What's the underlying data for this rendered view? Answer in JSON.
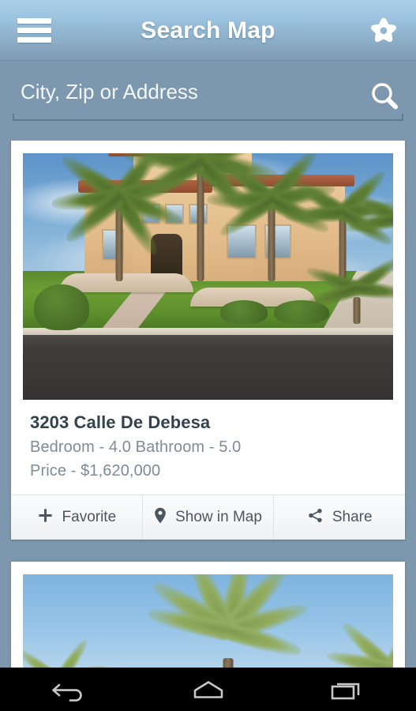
{
  "header": {
    "title": "Search Map",
    "menu_icon": "hamburger-menu-icon",
    "favorites_icon": "star-icon"
  },
  "search": {
    "placeholder": "City, Zip or Address",
    "value": "",
    "icon": "search-icon"
  },
  "listings": [
    {
      "address": "3203 Calle De Debesa",
      "beds_baths": "Bedroom - 4.0 Bathroom - 5.0",
      "price": "Price - $1,620,000",
      "photo_alt": "mediterranean-villa-with-palm-trees",
      "actions": [
        {
          "label": "Favorite",
          "icon": "plus-icon"
        },
        {
          "label": "Show in Map",
          "icon": "map-pin-icon"
        },
        {
          "label": "Share",
          "icon": "share-icon"
        }
      ]
    },
    {
      "photo_alt": "palm-trees-against-blue-sky"
    }
  ],
  "navbar": {
    "back": "back-icon",
    "home": "home-icon",
    "recents": "recents-icon"
  },
  "colors": {
    "page_background": "#7d97ae",
    "appbar_top": "#a9cfe9",
    "appbar_bottom": "#7e9bb2",
    "card_background": "#ffffff",
    "title_text": "#33424e",
    "meta_text": "#7c8c99",
    "action_text": "#4a5760",
    "navbar_background": "#000000"
  }
}
